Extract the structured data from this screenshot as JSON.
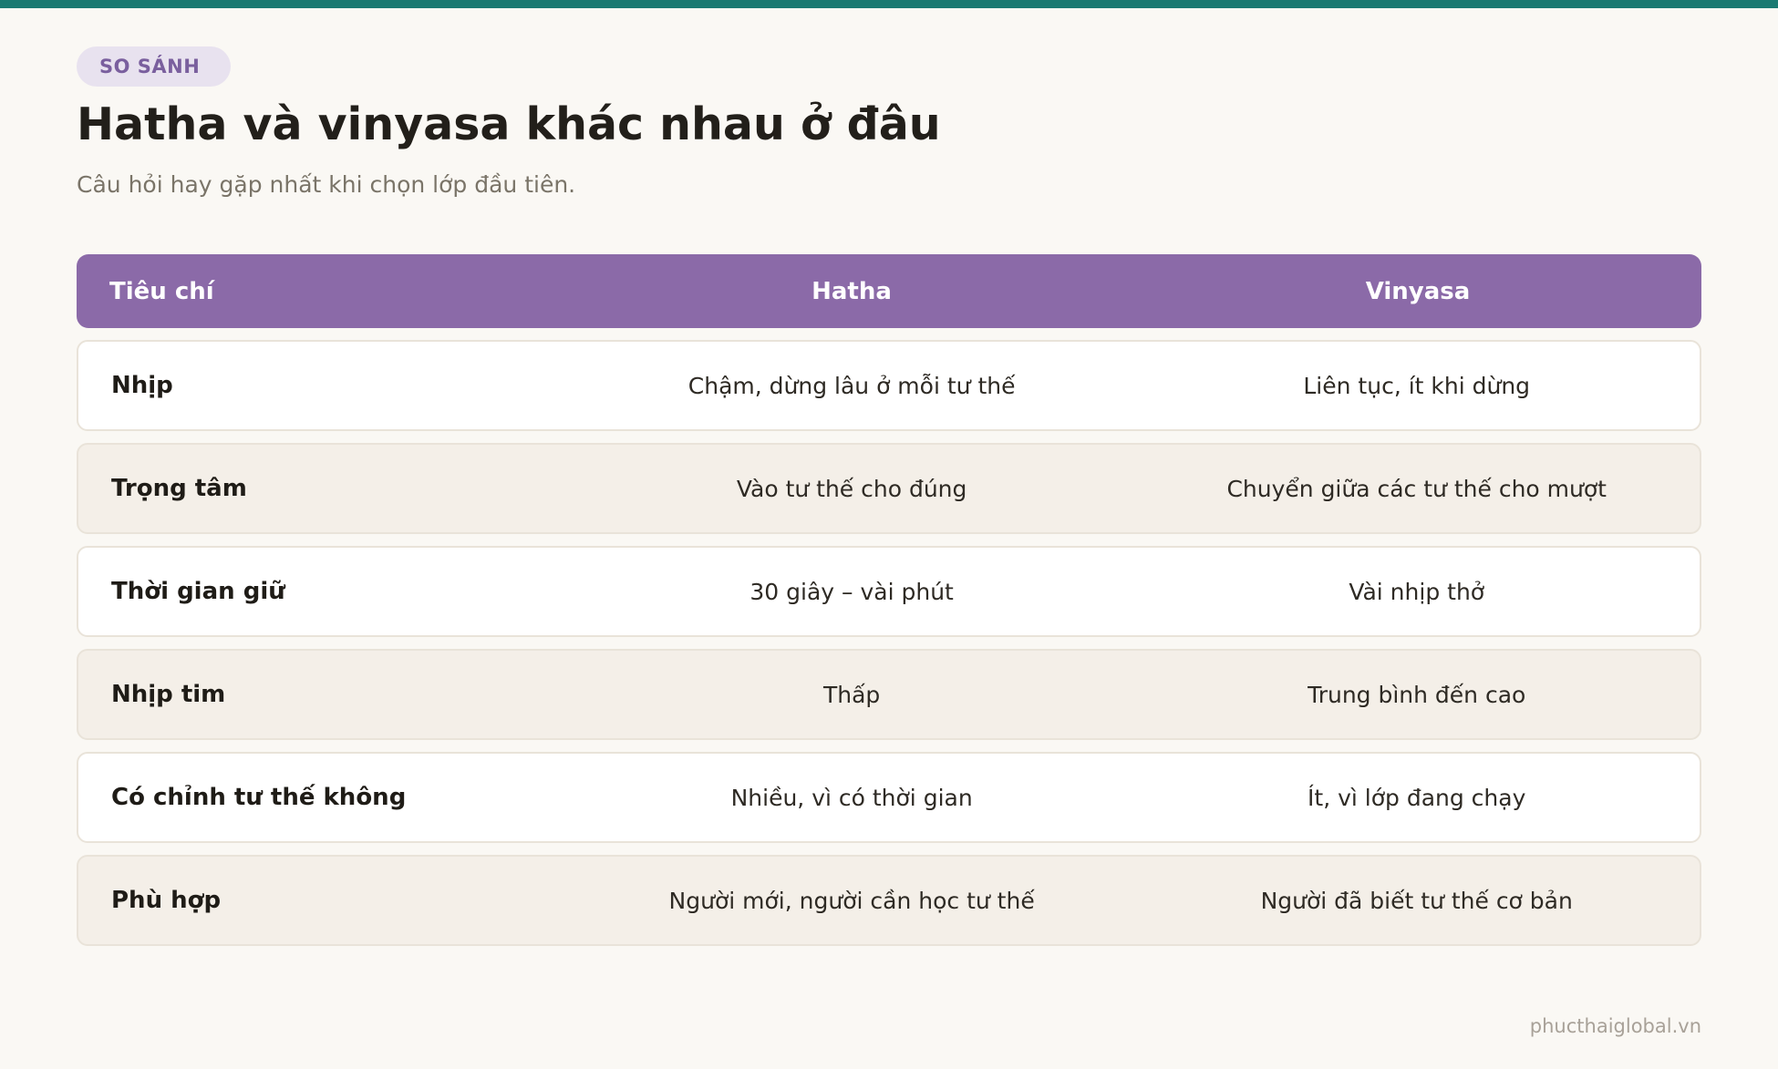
{
  "badge": "SO SÁNH",
  "title": "Hatha và vinyasa khác nhau ở đâu",
  "subtitle": "Câu hỏi hay gặp nhất khi chọn lớp đầu tiên.",
  "table": {
    "headers": [
      "Tiêu chí",
      "Hatha",
      "Vinyasa"
    ],
    "rows": [
      [
        "Nhịp",
        "Chậm, dừng lâu ở mỗi tư thế",
        "Liên tục, ít khi dừng"
      ],
      [
        "Trọng tâm",
        "Vào tư thế cho đúng",
        "Chuyển giữa các tư thế cho mượt"
      ],
      [
        "Thời gian giữ",
        "30 giây – vài phút",
        "Vài nhịp thở"
      ],
      [
        "Nhịp tim",
        "Thấp",
        "Trung bình đến cao"
      ],
      [
        "Có chỉnh tư thế không",
        "Nhiều, vì có thời gian",
        "Ít, vì lớp đang chạy"
      ],
      [
        "Phù hợp",
        "Người mới, người cần học tư thế",
        "Người đã biết tư thế cơ bản"
      ]
    ]
  },
  "footer": "phucthaiglobal.vn",
  "colors": {
    "accent_bar": "#1b7a72",
    "header_bg": "#8b6aa8",
    "badge_bg": "#e8e2ef",
    "row_alt_bg": "#f4efe8"
  }
}
